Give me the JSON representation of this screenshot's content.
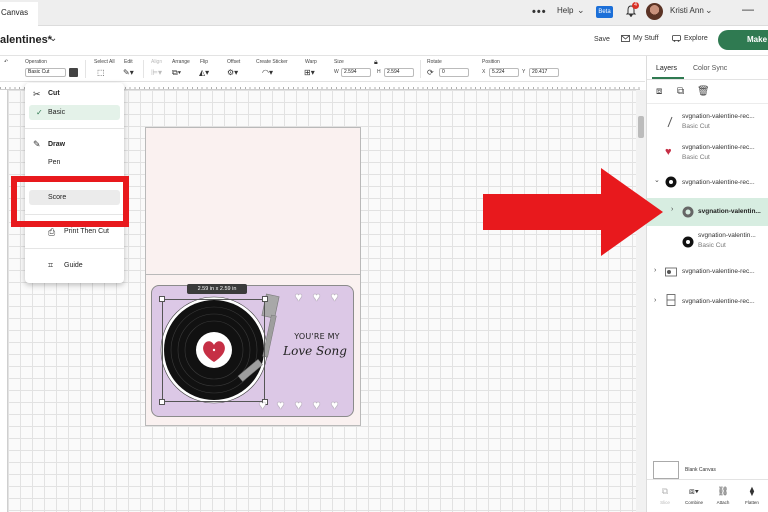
{
  "browser": {
    "tab_title": "Canvas",
    "menu_dots": "•••",
    "help": "Help",
    "beta": "Beta",
    "notification_count": "4",
    "user_name": "Kristi Ann",
    "minimize": "—"
  },
  "header": {
    "project_title": "alentines*",
    "save": "Save",
    "my_stuff": "My Stuff",
    "explore": "Explore",
    "make": "Make"
  },
  "toolbar": {
    "operation_label": "Operation",
    "operation_value": "Basic Cut",
    "select_all_label": "Select All",
    "edit_label": "Edit",
    "align_label": "Align",
    "arrange_label": "Arrange",
    "flip_label": "Flip",
    "offset_label": "Offset",
    "create_sticker_label": "Create Sticker",
    "warp_label": "Warp",
    "size_label": "Size",
    "size_w_letter": "W",
    "size_w": "2.594",
    "size_h_letter": "H",
    "size_h": "2.594",
    "rotate_label": "Rotate",
    "rotate_value": "0",
    "position_label": "Position",
    "pos_x_letter": "X",
    "pos_x": "5.224",
    "pos_y_letter": "Y",
    "pos_y": "20.417"
  },
  "menu": {
    "cut": "Cut",
    "basic": "Basic",
    "draw": "Draw",
    "pen": "Pen",
    "foil": "Foil",
    "score": "Score",
    "print_then_cut": "Print Then Cut",
    "guide": "Guide"
  },
  "canvas": {
    "size_badge": "2.59  in x 2.59  in",
    "message_line1": "YOU'RE MY",
    "message_line2": "Love Song",
    "accent_color": "#c62f45",
    "card_color": "#dcc8e6"
  },
  "panel": {
    "tab_layers": "Layers",
    "tab_color_sync": "Color Sync",
    "layers": [
      {
        "name": "svgnation-valentine-rec...",
        "sub": "Basic Cut"
      },
      {
        "name": "svgnation-valentine-rec...",
        "sub": "Basic Cut"
      },
      {
        "name": "svgnation-valentine-rec...",
        "sub": ""
      },
      {
        "name": "svgnation-valentin...",
        "sub": ""
      },
      {
        "name": "svgnation-valentin...",
        "sub": "Basic Cut"
      },
      {
        "name": "svgnation-valentine-rec...",
        "sub": ""
      },
      {
        "name": "svgnation-valentine-rec...",
        "sub": ""
      }
    ],
    "blank_canvas": "Blank Canvas",
    "bottom": {
      "slice": "Slice",
      "combine": "Combine",
      "attach": "Attach",
      "flatten": "Flatten"
    }
  },
  "annotation": {
    "highlight_color": "#e8191d"
  }
}
